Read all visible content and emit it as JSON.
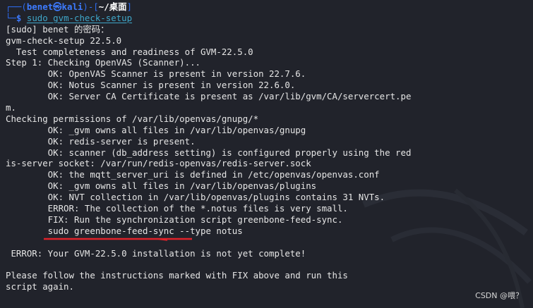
{
  "prompt": {
    "corner_top": "┌──(",
    "user": "benet",
    "skull": "㉿",
    "host": "kali",
    "sep": ")-[",
    "path": "~/桌面",
    "close": "]",
    "corner_bottom": "└─",
    "dollar": "$",
    "command": "sudo gvm-check-setup"
  },
  "output": [
    "[sudo] benet 的密码：",
    "gvm-check-setup 22.5.0",
    "  Test completeness and readiness of GVM-22.5.0",
    "Step 1: Checking OpenVAS (Scanner)...",
    "        OK: OpenVAS Scanner is present in version 22.7.6.",
    "        OK: Notus Scanner is present in version 22.6.0.",
    "        OK: Server CA Certificate is present as /var/lib/gvm/CA/servercert.pe",
    "m.",
    "Checking permissions of /var/lib/openvas/gnupg/*",
    "        OK: _gvm owns all files in /var/lib/openvas/gnupg",
    "        OK: redis-server is present.",
    "        OK: scanner (db_address setting) is configured properly using the red",
    "is-server socket: /var/run/redis-openvas/redis-server.sock",
    "        OK: the mqtt_server_uri is defined in /etc/openvas/openvas.conf",
    "        OK: _gvm owns all files in /var/lib/openvas/plugins",
    "        OK: NVT collection in /var/lib/openvas/plugins contains 31 NVTs.",
    "        ERROR: The collection of the *.notus files is very small.",
    "        FIX: Run the synchronization script greenbone-feed-sync.",
    "        sudo greenbone-feed-sync --type notus",
    "",
    " ERROR: Your GVM-22.5.0 installation is not yet complete!",
    "",
    "Please follow the instructions marked with FIX above and run this",
    "script again."
  ],
  "watermark": "CSDN @喂？",
  "colors": {
    "background": "#21232b",
    "prompt_blue": "#2e6cf0",
    "annotation_red": "#e0222a"
  }
}
